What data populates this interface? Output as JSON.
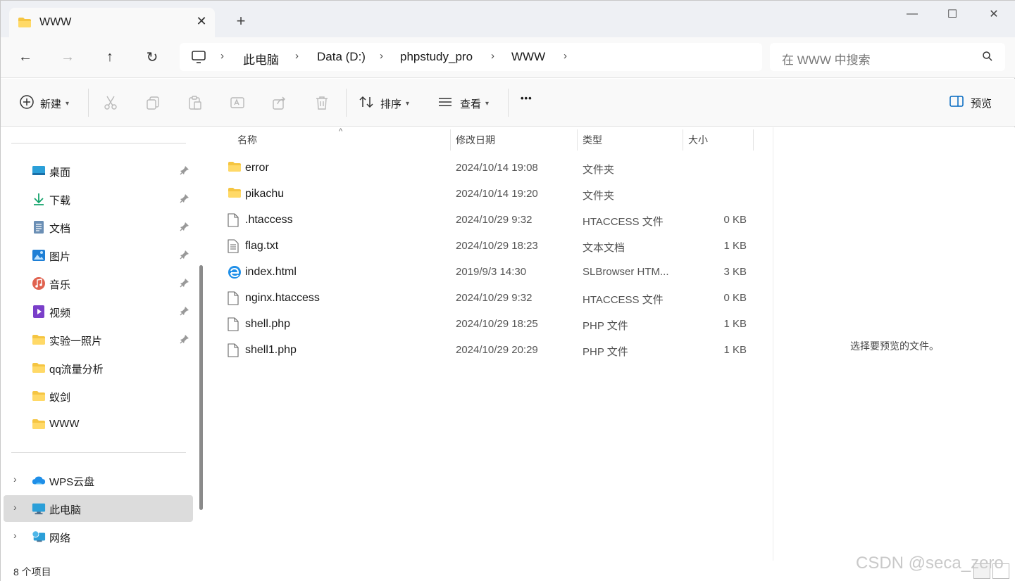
{
  "tab": {
    "title": "WWW",
    "close": "✕",
    "new": "+"
  },
  "window_controls": {
    "minimize": "—",
    "maximize": "☐",
    "close": "✕"
  },
  "nav": {
    "back": "←",
    "forward": "→",
    "up": "↑",
    "refresh": "↻"
  },
  "breadcrumb": {
    "sep": "›",
    "items": [
      "此电脑",
      "Data (D:)",
      "phpstudy_pro",
      "WWW"
    ]
  },
  "search": {
    "placeholder": "在 WWW 中搜索"
  },
  "toolbar": {
    "new_label": "新建",
    "sort_label": "排序",
    "view_label": "查看",
    "more": "•••",
    "preview_label": "预览"
  },
  "sidebar": {
    "quick": [
      {
        "label": "桌面",
        "icon": "desktop-icon",
        "pinned": true
      },
      {
        "label": "下载",
        "icon": "download-icon",
        "pinned": true
      },
      {
        "label": "文档",
        "icon": "document-icon",
        "pinned": true
      },
      {
        "label": "图片",
        "icon": "pictures-icon",
        "pinned": true
      },
      {
        "label": "音乐",
        "icon": "music-icon",
        "pinned": true
      },
      {
        "label": "视频",
        "icon": "video-icon",
        "pinned": true
      },
      {
        "label": "实验一照片",
        "icon": "folder-icon",
        "pinned": true
      },
      {
        "label": "qq流量分析",
        "icon": "folder-icon",
        "pinned": false
      },
      {
        "label": "蚁剑",
        "icon": "folder-icon",
        "pinned": false
      },
      {
        "label": "WWW",
        "icon": "folder-icon",
        "pinned": false
      }
    ],
    "roots": [
      {
        "label": "WPS云盘",
        "icon": "cloud-icon",
        "selected": false
      },
      {
        "label": "此电脑",
        "icon": "computer-icon",
        "selected": true
      },
      {
        "label": "网络",
        "icon": "network-icon",
        "selected": false
      }
    ]
  },
  "columns": {
    "name": "名称",
    "modified": "修改日期",
    "type": "类型",
    "size": "大小",
    "sort_indicator": "^"
  },
  "files": [
    {
      "name": "error",
      "date": "2024/10/14 19:08",
      "type": "文件夹",
      "size": "",
      "icon": "folder-icon"
    },
    {
      "name": "pikachu",
      "date": "2024/10/14 19:20",
      "type": "文件夹",
      "size": "",
      "icon": "folder-icon"
    },
    {
      "name": ".htaccess",
      "date": "2024/10/29 9:32",
      "type": "HTACCESS 文件",
      "size": "0 KB",
      "icon": "file-icon"
    },
    {
      "name": "flag.txt",
      "date": "2024/10/29 18:23",
      "type": "文本文档",
      "size": "1 KB",
      "icon": "text-file-icon"
    },
    {
      "name": "index.html",
      "date": "2019/9/3 14:30",
      "type": "SLBrowser HTM...",
      "size": "3 KB",
      "icon": "browser-file-icon"
    },
    {
      "name": "nginx.htaccess",
      "date": "2024/10/29 9:32",
      "type": "HTACCESS 文件",
      "size": "0 KB",
      "icon": "file-icon"
    },
    {
      "name": "shell.php",
      "date": "2024/10/29 18:25",
      "type": "PHP 文件",
      "size": "1 KB",
      "icon": "file-icon"
    },
    {
      "name": "shell1.php",
      "date": "2024/10/29 20:29",
      "type": "PHP 文件",
      "size": "1 KB",
      "icon": "file-icon"
    }
  ],
  "preview_pane": {
    "message": "选择要预览的文件。"
  },
  "status": {
    "count": "8 个项目"
  },
  "watermark": "CSDN @seca_zero",
  "colors": {
    "folder": "#f5c542",
    "accent": "#0067c0",
    "selected_bg": "#dcdcdc"
  }
}
